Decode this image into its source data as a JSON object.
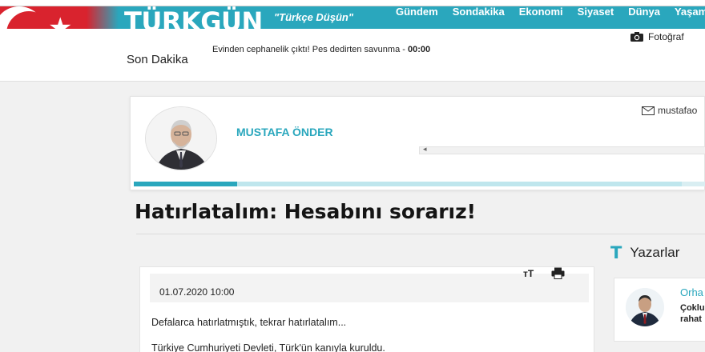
{
  "header": {
    "logo": "TÜRKGÜN",
    "slogan": "\"Türkçe Düşün\"",
    "nav": [
      "Gündem",
      "Sondakika",
      "Ekonomi",
      "Siyaset",
      "Dünya",
      "Yaşam"
    ],
    "photo_label": "Fotoğraf"
  },
  "subbar": {
    "section_label": "Son Dakika",
    "ticker_text": "Evinden cephanelik çıktı! Pes dedirten savunma - ",
    "ticker_time": "00:00"
  },
  "author": {
    "name": "MUSTAFA ÖNDER",
    "email_partial": "mustafao",
    "progress_fraction": 0.18
  },
  "article": {
    "title": "Hatırlatalım: Hesabını sorarız!",
    "date": "01.07.2020 10:00",
    "font_tool_label": "тT",
    "paragraphs": [
      "Defalarca hatırlatmıştık, tekrar hatırlatalım...",
      "Türkiye Cumhuriyeti Devleti, Türk'ün kanıyla kuruldu."
    ]
  },
  "sidebar": {
    "heading_icon": "T",
    "heading": "Yazarlar",
    "writer_name": "Orha",
    "writer_title": "Çoklu rahat"
  },
  "colors": {
    "brand": "#2aa7bd",
    "flag_red": "#d9232e"
  },
  "icons": [
    "camera-icon",
    "mail-icon",
    "print-icon",
    "font-size-icon",
    "scroll-left-icon"
  ]
}
